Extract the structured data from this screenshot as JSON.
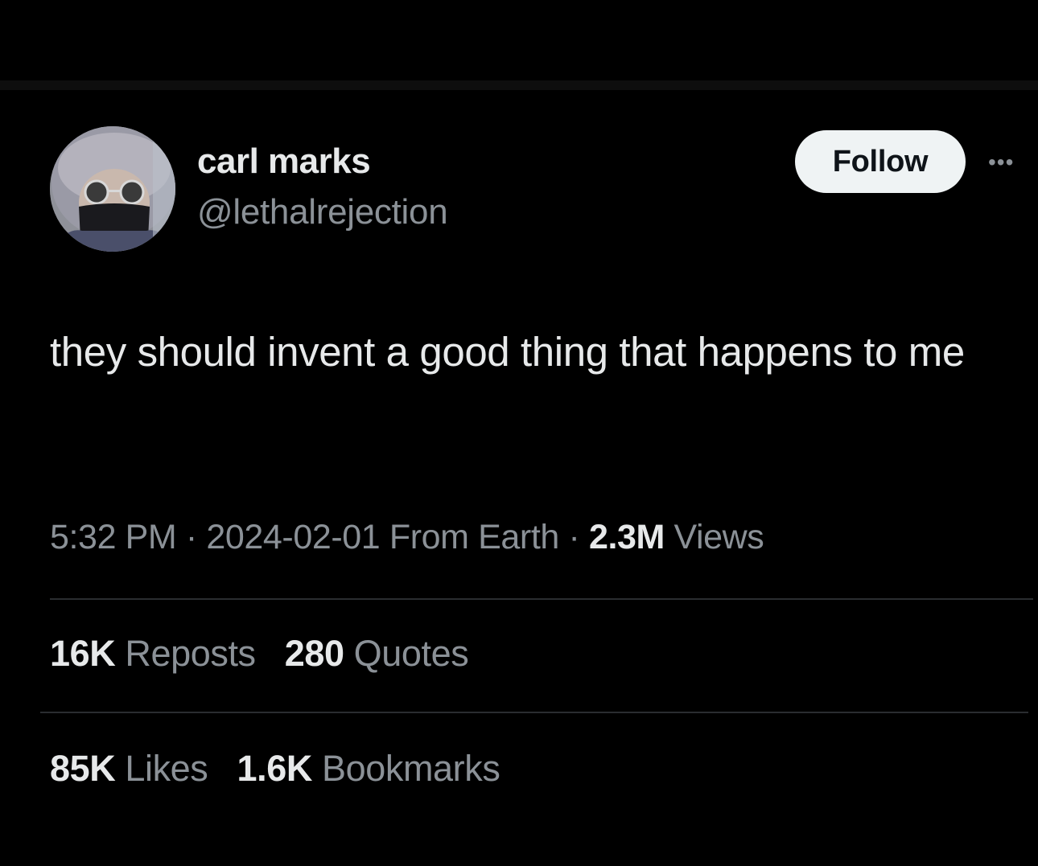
{
  "colors": {
    "background": "#000000",
    "primary_text": "#e7e9ea",
    "secondary_text": "#8b9197",
    "follow_button_bg": "#eff3f4",
    "divider": "#2a2d30"
  },
  "author": {
    "display_name": "carl marks",
    "handle": "@lethalrejection",
    "avatar_icon": "profile-photo-hooded-person-sunglasses-mask"
  },
  "actions": {
    "follow_label": "Follow",
    "more_icon": "more-horizontal-icon"
  },
  "tweet": {
    "text": "they should invent a good thing that happens to me"
  },
  "meta": {
    "time": "5:32 PM",
    "separator": "·",
    "date": "2024-02-01",
    "source": "From Earth",
    "views_count": "2.3M",
    "views_label": "Views"
  },
  "stats": {
    "reposts_count": "16K",
    "reposts_label": "Reposts",
    "quotes_count": "280",
    "quotes_label": "Quotes",
    "likes_count": "85K",
    "likes_label": "Likes",
    "bookmarks_count": "1.6K",
    "bookmarks_label": "Bookmarks"
  }
}
